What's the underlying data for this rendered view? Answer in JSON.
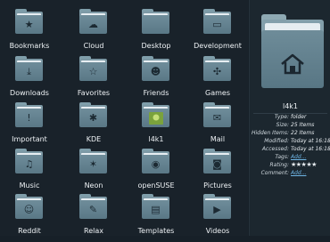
{
  "grid": {
    "items": [
      {
        "label": "Bookmarks",
        "icon": "bookmark-icon",
        "glyph": "★"
      },
      {
        "label": "Cloud",
        "icon": "cloud-icon",
        "glyph": "☁"
      },
      {
        "label": "Desktop",
        "icon": "desktop-icon",
        "glyph": ""
      },
      {
        "label": "Development",
        "icon": "code-icon",
        "glyph": "▭"
      },
      {
        "label": "Downloads",
        "icon": "download-icon",
        "glyph": "⤓"
      },
      {
        "label": "Favorites",
        "icon": "star-icon",
        "glyph": "☆"
      },
      {
        "label": "Friends",
        "icon": "people-icon",
        "glyph": "☻"
      },
      {
        "label": "Games",
        "icon": "gamepad-icon",
        "glyph": "✣"
      },
      {
        "label": "Important",
        "icon": "exclamation-icon",
        "glyph": "!"
      },
      {
        "label": "KDE",
        "icon": "kde-gear-icon",
        "glyph": "✱"
      },
      {
        "label": "l4k1",
        "icon": "user-picture-icon",
        "glyph": "❀"
      },
      {
        "label": "Mail",
        "icon": "mail-icon",
        "glyph": "✉"
      },
      {
        "label": "Music",
        "icon": "music-note-icon",
        "glyph": "♫"
      },
      {
        "label": "Neon",
        "icon": "neon-icon",
        "glyph": "✶"
      },
      {
        "label": "openSUSE",
        "icon": "opensuse-icon",
        "glyph": "◉"
      },
      {
        "label": "Pictures",
        "icon": "camera-icon",
        "glyph": "◙"
      },
      {
        "label": "Reddit",
        "icon": "reddit-icon",
        "glyph": "☺"
      },
      {
        "label": "Relax",
        "icon": "relax-icon",
        "glyph": "✎"
      },
      {
        "label": "Templates",
        "icon": "templates-icon",
        "glyph": "▤"
      },
      {
        "label": "Videos",
        "icon": "video-icon",
        "glyph": "▶"
      }
    ]
  },
  "panel": {
    "title": "l4k1",
    "icon": "home-folder-icon",
    "rows": [
      {
        "key": "Type:",
        "value": "folder"
      },
      {
        "key": "Size:",
        "value": "25 Items"
      },
      {
        "key": "Hidden Items:",
        "value": "22 Items"
      },
      {
        "key": "Modified:",
        "value": "Today at 16:18"
      },
      {
        "key": "Accessed:",
        "value": "Today at 16:18"
      },
      {
        "key": "Tags:",
        "value": "Add..."
      },
      {
        "key": "Rating:",
        "value": "★★★★★"
      },
      {
        "key": "Comment:",
        "value": "Add..."
      }
    ]
  },
  "colors": {
    "background": "#19222a",
    "folder": "#6f8d9a",
    "accent": "#3fa9e6"
  }
}
